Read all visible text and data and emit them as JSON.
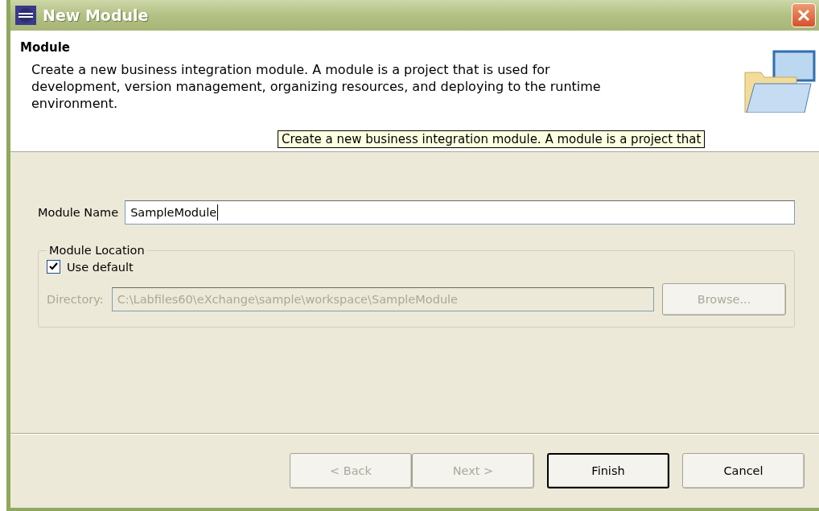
{
  "window": {
    "title": "New Module"
  },
  "header": {
    "title": "Module",
    "description": "Create a new business integration module. A module is a project that is used for development, version management, organizing resources, and deploying to the runtime environment.",
    "tooltip": "Create a new business integration module. A module is a project that"
  },
  "module_name": {
    "label": "Module Name",
    "value": "SampleModule"
  },
  "location": {
    "title": "Module Location",
    "use_default": {
      "label": "Use default",
      "checked": true
    },
    "directory": {
      "label": "Directory:",
      "value": "C:\\Labfiles60\\eXchange\\sample\\workspace\\SampleModule",
      "disabled": true
    },
    "browse": {
      "label": "Browse...",
      "disabled": true
    }
  },
  "buttons": [
    {
      "label": "< Back",
      "disabled": true,
      "default": false
    },
    {
      "label": "Next >",
      "disabled": true,
      "default": false
    },
    {
      "label": "Finish",
      "disabled": false,
      "default": true
    },
    {
      "label": "Cancel",
      "disabled": false,
      "default": false
    }
  ]
}
